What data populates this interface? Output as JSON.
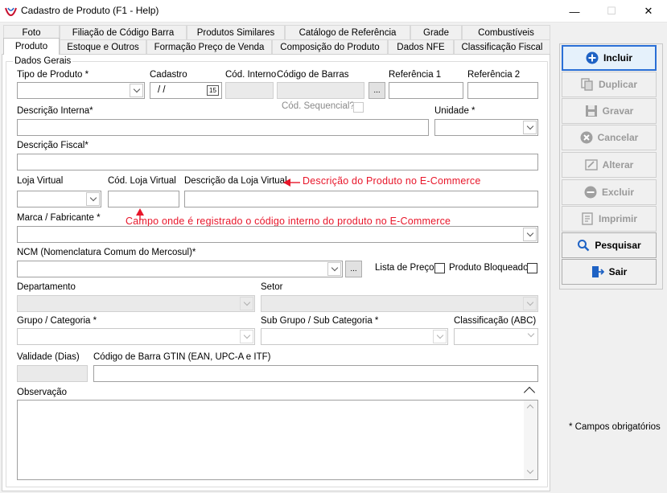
{
  "window": {
    "title": "Cadastro de Produto (F1 - Help)",
    "minimize": "—",
    "maximize": "☐",
    "close": "✕"
  },
  "tabs_row1": [
    "Foto",
    "Filiação de Código Barra",
    "Produtos Similares",
    "Catálogo de Referência",
    "Grade",
    "Combustíveis"
  ],
  "tabs_row2": [
    "Produto",
    "Estoque e Outros",
    "Formação Preço de Venda",
    "Composição do Produto",
    "Dados NFE",
    "Classificação Fiscal"
  ],
  "active_tab": "Produto",
  "group_title": "Dados Gerais",
  "fields": {
    "tipo_produto": {
      "label": "Tipo de Produto *",
      "value": ""
    },
    "cadastro": {
      "label": "Cadastro",
      "value": " /  /"
    },
    "cod_interno": {
      "label": "Cód. Interno",
      "value": ""
    },
    "codigo_barras": {
      "label": "Código de Barras",
      "value": ""
    },
    "referencia1": {
      "label": "Referência 1",
      "value": ""
    },
    "referencia2": {
      "label": "Referência 2",
      "value": ""
    },
    "cod_sequencial": {
      "label": "Cód. Sequencial?"
    },
    "descricao_interna": {
      "label": "Descrição Interna*",
      "value": ""
    },
    "unidade": {
      "label": "Unidade *",
      "value": ""
    },
    "descricao_fiscal": {
      "label": "Descrição Fiscal*",
      "value": ""
    },
    "loja_virtual": {
      "label": "Loja Virtual",
      "value": ""
    },
    "cod_loja_virtual": {
      "label": "Cód. Loja Virtual",
      "value": ""
    },
    "descricao_loja_virtual": {
      "label": "Descrição da Loja Virtual",
      "value": ""
    },
    "marca": {
      "label": "Marca / Fabricante *",
      "value": ""
    },
    "ncm": {
      "label": "NCM (Nomenclatura Comum do Mercosul)*",
      "value": ""
    },
    "lista_preco": {
      "label": "Lista de Preço"
    },
    "produto_bloqueado": {
      "label": "Produto Bloqueado"
    },
    "departamento": {
      "label": "Departamento",
      "value": ""
    },
    "setor": {
      "label": "Setor",
      "value": ""
    },
    "grupo": {
      "label": "Grupo / Categoria *",
      "value": ""
    },
    "sub_grupo": {
      "label": "Sub Grupo / Sub Categoria *",
      "value": ""
    },
    "classificacao": {
      "label": "Classificação (ABC)",
      "value": ""
    },
    "validade": {
      "label": "Validade (Dias)",
      "value": ""
    },
    "gtin": {
      "label": "Código de Barra GTIN (EAN, UPC-A e ITF)",
      "value": ""
    },
    "observacao": {
      "label": "Observação",
      "value": ""
    }
  },
  "dots_label": "...",
  "calendar_glyph": "15",
  "annotations": {
    "descricao_ecommerce": "Descrição do Produto no E-Commerce",
    "codigo_ecommerce": "Campo onde é registrado o código interno do produto no E-Commerce"
  },
  "buttons": [
    {
      "label": "Incluir",
      "icon": "plus-circle-icon",
      "enabled": true
    },
    {
      "label": "Duplicar",
      "icon": "duplicate-icon",
      "enabled": false
    },
    {
      "label": "Gravar",
      "icon": "save-icon",
      "enabled": false
    },
    {
      "label": "Cancelar",
      "icon": "cancel-icon",
      "enabled": false
    },
    {
      "label": "Alterar",
      "icon": "edit-icon",
      "enabled": false
    },
    {
      "label": "Excluir",
      "icon": "minus-circle-icon",
      "enabled": false
    },
    {
      "label": "Imprimir",
      "icon": "print-icon",
      "enabled": false
    },
    {
      "label": "Pesquisar",
      "icon": "search-icon",
      "enabled": true
    },
    {
      "label": "Sair",
      "icon": "exit-icon",
      "enabled": true
    }
  ],
  "required_note": "* Campos obrigatórios",
  "colors": {
    "annotation": "#e8162a",
    "primary_icon": "#1e62c4"
  }
}
